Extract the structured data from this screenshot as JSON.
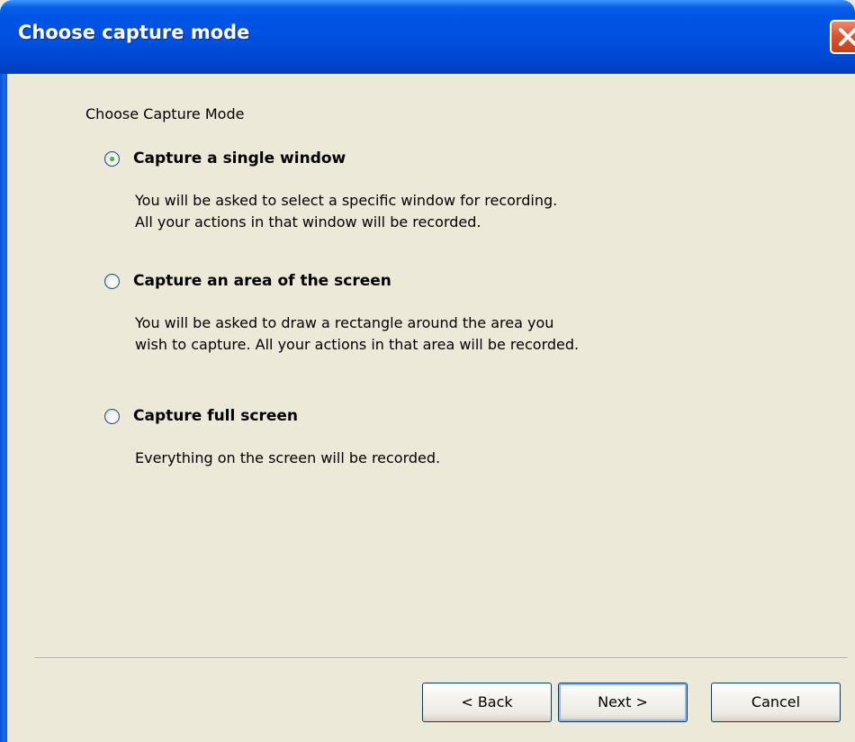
{
  "window": {
    "title": "Choose capture mode"
  },
  "heading": "Choose Capture Mode",
  "options": [
    {
      "label": "Capture a single window",
      "selected": true,
      "description": [
        "You will be asked to select a specific window for recording.",
        "All your actions in that window will be recorded."
      ]
    },
    {
      "label": "Capture an area of the screen",
      "selected": false,
      "description": [
        "You will be asked to draw a rectangle around the area you",
        "wish to capture. All your actions in that area will be recorded."
      ]
    },
    {
      "label": "Capture full screen",
      "selected": false,
      "description": [
        "Everything on the screen will be recorded."
      ]
    }
  ],
  "buttons": {
    "back": "< Back",
    "next": "Next >",
    "cancel": "Cancel"
  },
  "colors": {
    "title_bar": "#0055e5",
    "dialog_background": "#ece9d8",
    "close_button": "#d9542f",
    "radio_selected_dot": "#21a121"
  },
  "icons": {
    "close": "close-icon"
  }
}
